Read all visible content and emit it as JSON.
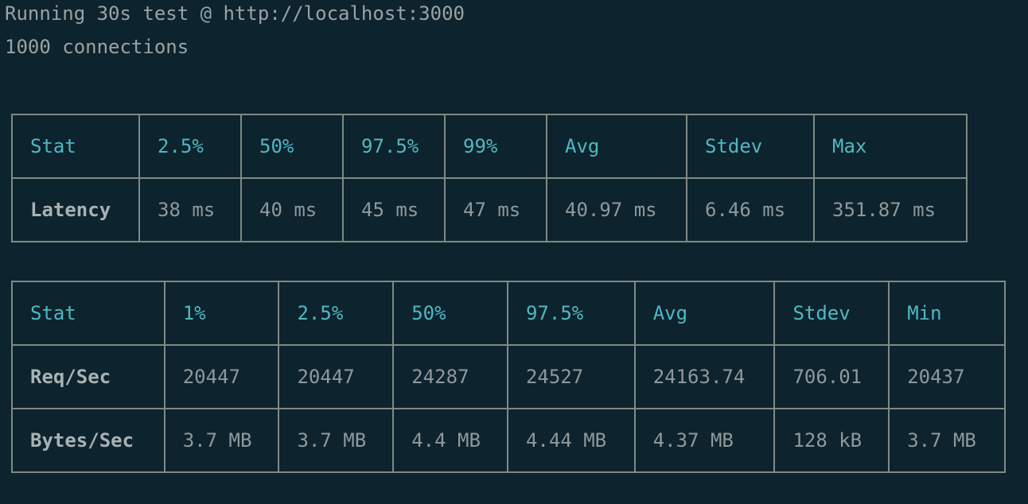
{
  "terminal": {
    "line1": "Running 30s test @ http://localhost:3000",
    "line2": "1000 connections"
  },
  "latency_table": {
    "headers": [
      "Stat",
      "2.5%",
      "50%",
      "97.5%",
      "99%",
      "Avg",
      "Stdev",
      "Max"
    ],
    "rows": [
      [
        "Latency",
        "38 ms",
        "40 ms",
        "45 ms",
        "47 ms",
        "40.97 ms",
        "6.46 ms",
        "351.87 ms"
      ]
    ]
  },
  "throughput_table": {
    "headers": [
      "Stat",
      "1%",
      "2.5%",
      "50%",
      "97.5%",
      "Avg",
      "Stdev",
      "Min"
    ],
    "rows": [
      [
        "Req/Sec",
        "20447",
        "20447",
        "24287",
        "24527",
        "24163.74",
        "706.01",
        "20437"
      ],
      [
        "Bytes/Sec",
        "3.7 MB",
        "3.7 MB",
        "4.4 MB",
        "4.44 MB",
        "4.37 MB",
        "128 kB",
        "3.7 MB"
      ]
    ]
  },
  "colors": {
    "background": "#0d232d",
    "header_text": "#4fb8c4",
    "body_text": "#8f999b",
    "border": "#7f8a84"
  }
}
